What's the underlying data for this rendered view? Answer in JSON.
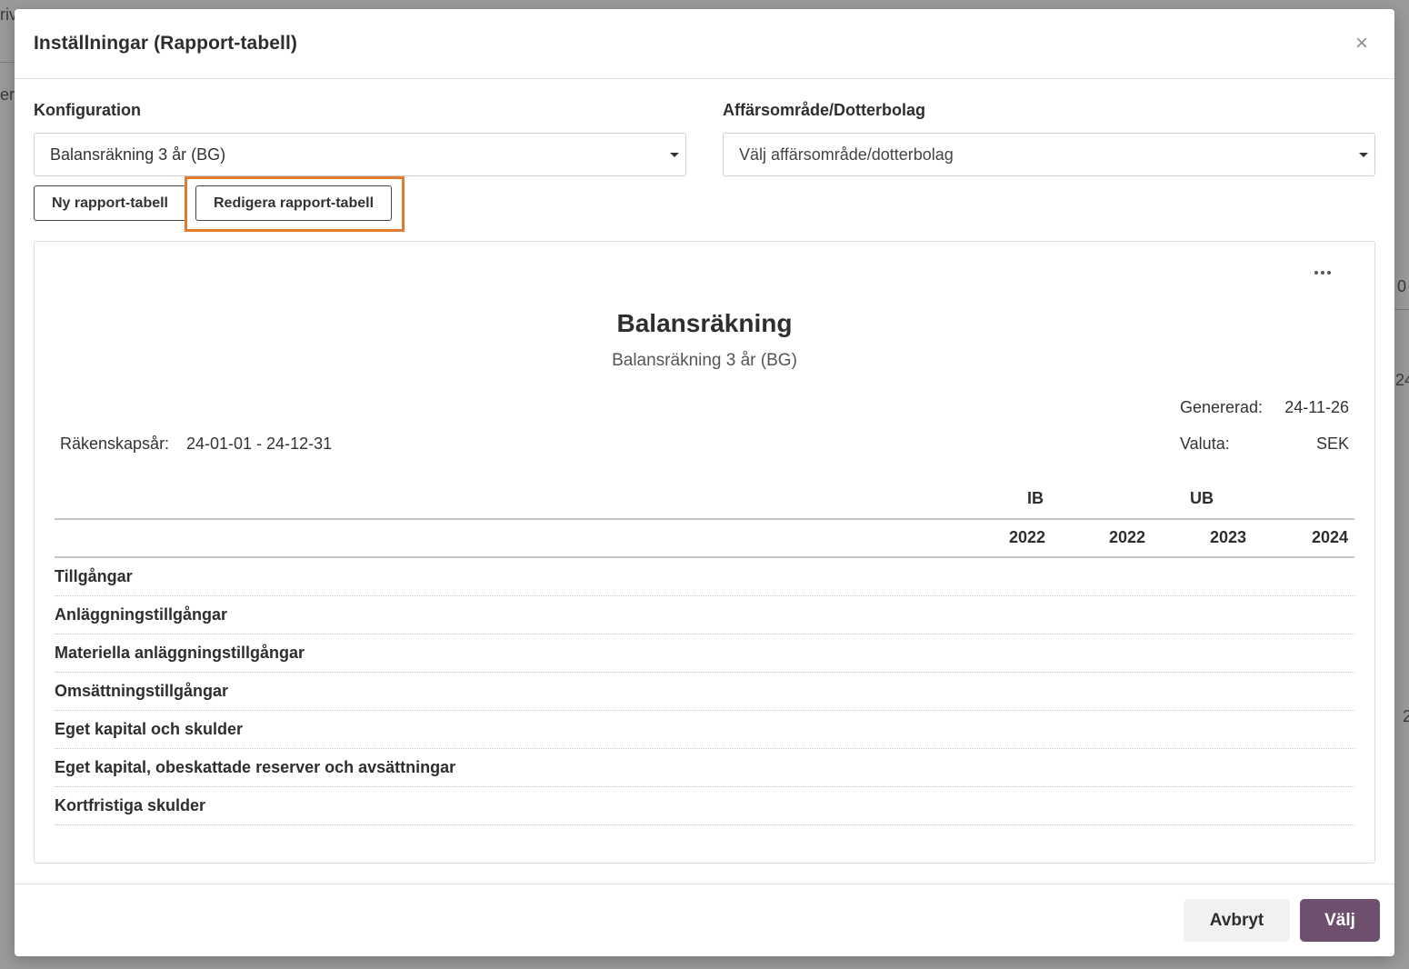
{
  "background": {
    "fragments": [
      "riv",
      "er",
      "0",
      "24",
      "2"
    ]
  },
  "modal": {
    "title": "Inställningar (Rapport-tabell)",
    "close_icon": "close-icon"
  },
  "config": {
    "label": "Konfiguration",
    "selected": "Balansräkning 3 år (BG)"
  },
  "business_area": {
    "label": "Affärsområde/Dotterbolag",
    "placeholder": "Välj affärsområde/dotterbolag"
  },
  "actions": {
    "new_label": "Ny rapport-tabell",
    "edit_label": "Redigera rapport-tabell"
  },
  "report": {
    "title": "Balansräkning",
    "subtitle": "Balansräkning 3 år (BG)",
    "fiscal_year_label": "Räkenskapsår:",
    "fiscal_year_value": "24-01-01 - 24-12-31",
    "generated_label": "Genererad:",
    "generated_value": "24-11-26",
    "currency_label": "Valuta:",
    "currency_value": "SEK",
    "group_headers": [
      "IB",
      "UB"
    ],
    "year_headers": [
      "2022",
      "2022",
      "2023",
      "2024"
    ],
    "rows": [
      "Tillgångar",
      "Anläggningstillgångar",
      "Materiella anläggningstillgångar",
      "Omsättningstillgångar",
      "Eget kapital och skulder",
      "Eget kapital, obeskattade reserver och avsättningar",
      "Kortfristiga skulder"
    ]
  },
  "footer": {
    "cancel_label": "Avbryt",
    "confirm_label": "Välj"
  },
  "colors": {
    "primary": "#6e4f6d",
    "highlight": "#e07b2f"
  }
}
